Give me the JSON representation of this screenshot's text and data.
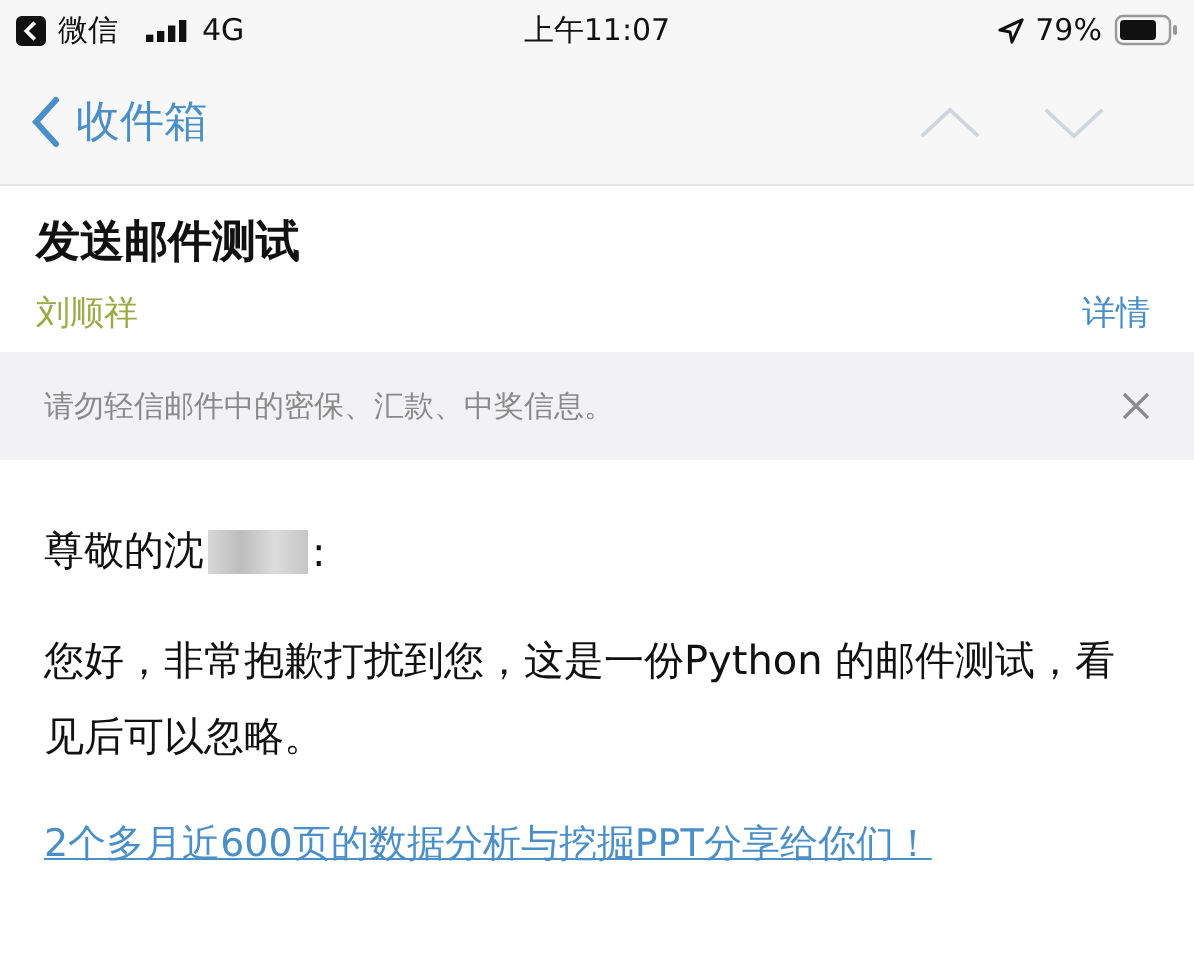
{
  "status_bar": {
    "back_app": "微信",
    "network": "4G",
    "time": "上午11:07",
    "battery": "79%"
  },
  "nav": {
    "back": "收件箱",
    "prev_enabled": false,
    "next_enabled": false
  },
  "message": {
    "subject": "发送邮件测试",
    "sender": "刘顺祥",
    "details": "详情"
  },
  "warning": {
    "text": "请勿轻信邮件中的密保、汇款、中奖信息。"
  },
  "body": {
    "greeting": {
      "before": "尊敬的沈",
      "after": ":"
    },
    "paragraph": "您好，非常抱歉打扰到您，这是一份Python 的邮件测试，看见后可以忽略。",
    "link": "2个多月近600页的数据分析与挖掘PPT分享给你们！"
  }
}
